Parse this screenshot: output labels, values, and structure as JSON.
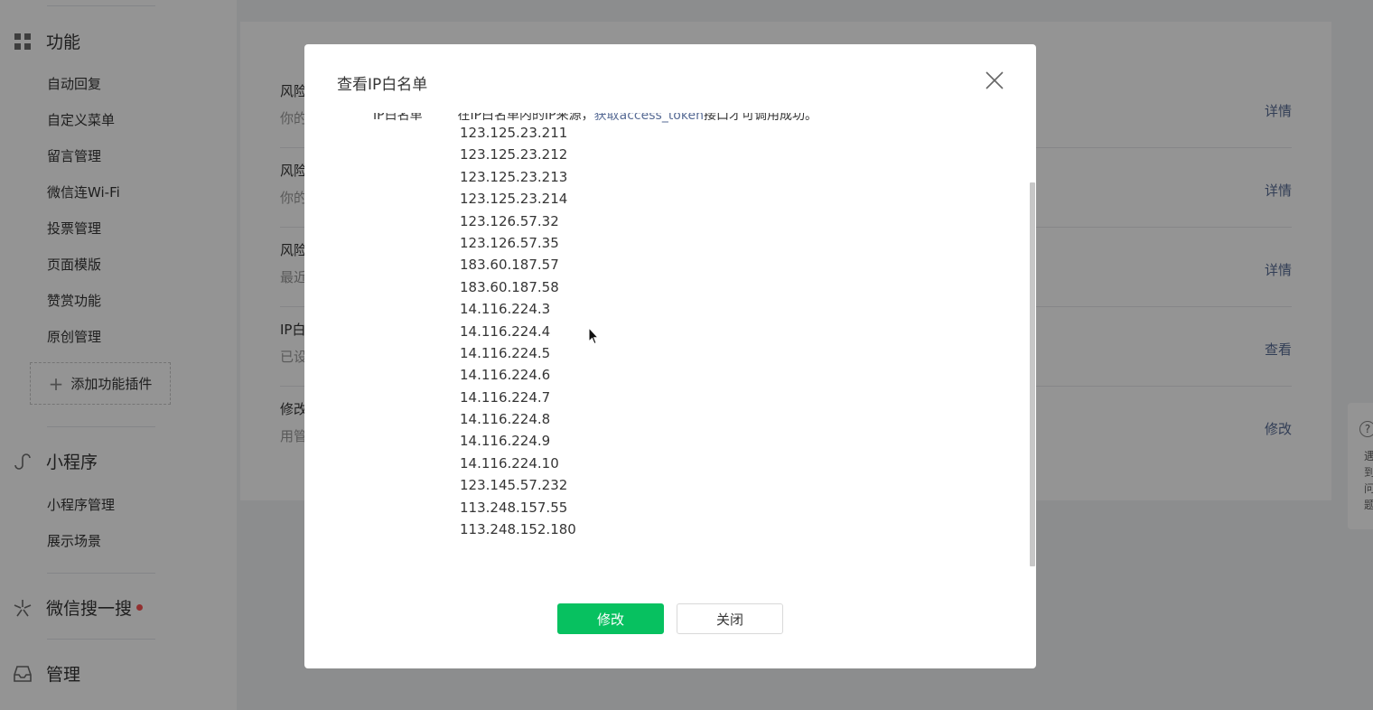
{
  "sidebar": {
    "sections": [
      {
        "title": "功能",
        "icon": "grid-icon"
      },
      {
        "title": "小程序",
        "icon": "mini-program-icon"
      },
      {
        "title": "微信搜一搜",
        "icon": "search-star-icon"
      },
      {
        "title": "管理",
        "icon": "inbox-icon"
      }
    ],
    "feature_items": [
      "自动回复",
      "自定义菜单",
      "留言管理",
      "微信连Wi-Fi",
      "投票管理",
      "页面模版",
      "赞赏功能",
      "原创管理"
    ],
    "add_plugin_label": "添加功能插件",
    "mini_items": [
      "小程序管理",
      "展示场景"
    ]
  },
  "main": {
    "rows": [
      {
        "title": "风险",
        "desc": "你的",
        "link": "详情"
      },
      {
        "title": "风险",
        "desc": "你的",
        "link": "详情"
      },
      {
        "title": "风险",
        "desc": "最近",
        "link": "详情"
      },
      {
        "title": "IP白",
        "desc": "已设",
        "link": "查看"
      },
      {
        "title": "修改",
        "desc": "用管",
        "link": "修改"
      }
    ]
  },
  "help": {
    "text": "遇到问题"
  },
  "dialog": {
    "title": "查看IP白名单",
    "clipped_label": "IP白名单",
    "clipped_text_a": "在IP白名单内的IP来源，",
    "clipped_text_link": "获取access_token",
    "clipped_text_b": "接口才可调用成功。",
    "ips": [
      "123.125.23.211",
      "123.125.23.212",
      "123.125.23.213",
      "123.125.23.214",
      "123.126.57.32",
      "123.126.57.35",
      "183.60.187.57",
      "183.60.187.58",
      "14.116.224.3",
      "14.116.224.4",
      "14.116.224.5",
      "14.116.224.6",
      "14.116.224.7",
      "14.116.224.8",
      "14.116.224.9",
      "14.116.224.10",
      "123.145.57.232",
      "113.248.157.55",
      "113.248.152.180"
    ],
    "primary_button": "修改",
    "secondary_button": "关闭"
  },
  "colors": {
    "accent": "#07c160",
    "link": "#576b95"
  }
}
